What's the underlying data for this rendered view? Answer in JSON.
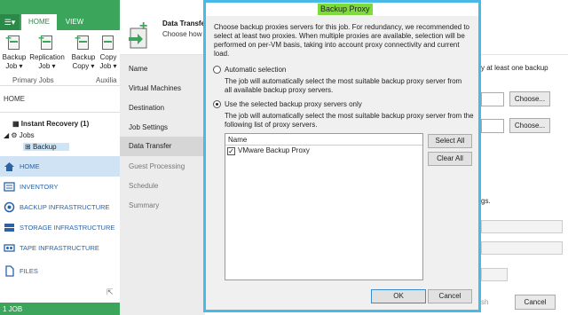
{
  "ribbon": {
    "menu_icon": "menu-icon",
    "tabs": [
      "HOME",
      "VIEW"
    ],
    "buttons": [
      {
        "label1": "Backup",
        "label2": "Job ▾"
      },
      {
        "label1": "Replication",
        "label2": "Job ▾"
      },
      {
        "label1": "Backup",
        "label2": "Copy ▾"
      },
      {
        "label1": "Copy",
        "label2": "Job ▾"
      }
    ],
    "groups": [
      "Primary Jobs",
      "Auxilia"
    ]
  },
  "breadcrumb": "HOME",
  "tree": {
    "instant_recovery": "Instant Recovery (1)",
    "jobs": "Jobs",
    "backup": "Backup"
  },
  "nav": [
    {
      "label": "HOME",
      "icon": "home-icon"
    },
    {
      "label": "INVENTORY",
      "icon": "inventory-icon"
    },
    {
      "label": "BACKUP INFRASTRUCTURE",
      "icon": "backup-infrastructure-icon"
    },
    {
      "label": "STORAGE INFRASTRUCTURE",
      "icon": "storage-icon"
    },
    {
      "label": "TAPE INFRASTRUCTURE",
      "icon": "tape-icon"
    },
    {
      "label": "FILES",
      "icon": "files-icon"
    }
  ],
  "status_bar": "1 JOB",
  "wizard": {
    "title": "Data Transfer",
    "subtitle": "Choose how",
    "steps": [
      "Name",
      "Virtual Machines",
      "Destination",
      "Job Settings",
      "Data Transfer",
      "Guest Processing",
      "Schedule",
      "Summary"
    ],
    "right_text1": "y at least one backup",
    "right_text2": "gs.",
    "choose_label": "Choose...",
    "finish_fragment": "sh",
    "cancel_label": "Cancel"
  },
  "dialog": {
    "title": "Backup Proxy",
    "description": "Choose backup proxies servers for this job. For redundancy, we recommended to select at least two proxies. When multiple proxies are available, selection will be performed on per-VM basis, taking into account proxy connectivity and current load.",
    "auto_label": "Automatic selection",
    "auto_desc": "The job will automatically select the most suitable backup proxy server from all available backup proxy servers.",
    "selected_label": "Use the selected backup proxy servers only",
    "selected_desc": "The job will automatically select the most suitable backup proxy server from the following list of proxy servers.",
    "mode": "selected",
    "list_header": "Name",
    "proxies": [
      {
        "name": "VMware Backup Proxy",
        "checked": true
      }
    ],
    "select_all": "Select All",
    "clear_all": "Clear All",
    "ok": "OK",
    "cancel": "Cancel"
  }
}
